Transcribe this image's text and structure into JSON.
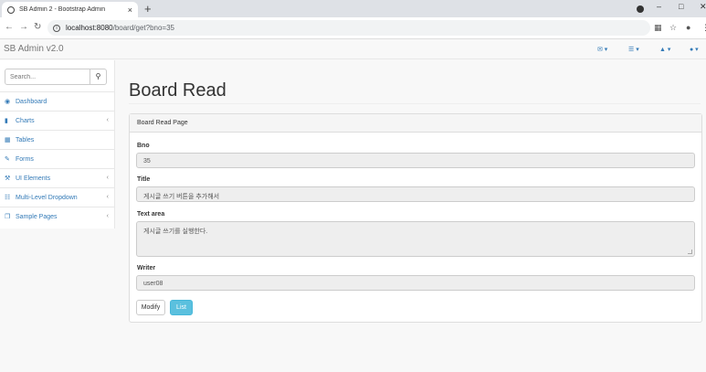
{
  "browser": {
    "tab_title": "SB Admin 2 - Bootstrap Admin",
    "new_tab_symbol": "+",
    "close_symbol": "×",
    "url_host": "localhost:8080",
    "url_path": "/board/get?bno=35"
  },
  "app": {
    "brand": "SB Admin v2.0",
    "nav_icons": [
      "envelope-icon",
      "tasks-icon",
      "bell-icon",
      "user-icon"
    ]
  },
  "sidebar": {
    "search_placeholder": "Search...",
    "items": [
      {
        "label": "Dashboard",
        "icon": "dashboard-icon",
        "has_children": false
      },
      {
        "label": "Charts",
        "icon": "bar-chart-icon",
        "has_children": true
      },
      {
        "label": "Tables",
        "icon": "table-icon",
        "has_children": false
      },
      {
        "label": "Forms",
        "icon": "edit-icon",
        "has_children": false
      },
      {
        "label": "UI Elements",
        "icon": "wrench-icon",
        "has_children": true
      },
      {
        "label": "Multi-Level Dropdown",
        "icon": "sitemap-icon",
        "has_children": true
      },
      {
        "label": "Sample Pages",
        "icon": "files-icon",
        "has_children": true
      }
    ]
  },
  "main": {
    "title": "Board Read",
    "panel_heading": "Board Read Page",
    "fields": {
      "bno_label": "Bno",
      "bno_value": "35",
      "title_label": "Title",
      "title_value": "게시글 쓰기 버튼을 추가해서",
      "content_label": "Text area",
      "content_value": "게시글 쓰기를 실행한다.",
      "writer_label": "Writer",
      "writer_value": "user08"
    },
    "buttons": {
      "modify": "Modify",
      "list": "List"
    }
  },
  "colors": {
    "link": "#337ab7",
    "info_button": "#5bc0de"
  }
}
